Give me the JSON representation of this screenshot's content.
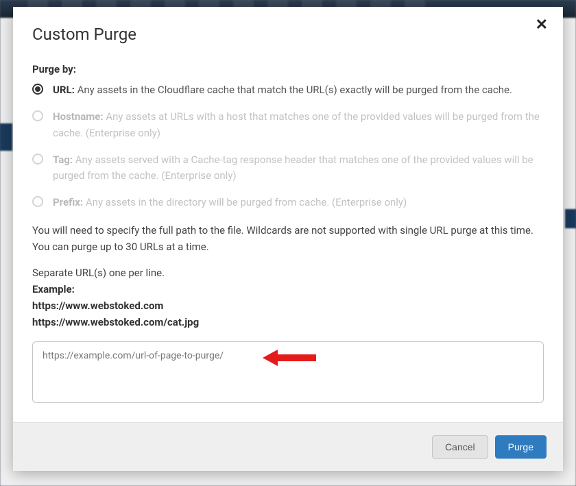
{
  "modal": {
    "title": "Custom Purge",
    "purge_by_label": "Purge by:",
    "options": [
      {
        "label": "URL:",
        "desc": "Any assets in the Cloudflare cache that match the URL(s) exactly will be purged from the cache.",
        "selected": true,
        "disabled": false
      },
      {
        "label": "Hostname:",
        "desc": "Any assets at URLs with a host that matches one of the provided values will be purged from the cache. (Enterprise only)",
        "selected": false,
        "disabled": true
      },
      {
        "label": "Tag:",
        "desc": "Any assets served with a Cache-tag response header that matches one of the provided values will be purged from the cache. (Enterprise only)",
        "selected": false,
        "disabled": true
      },
      {
        "label": "Prefix:",
        "desc": "Any assets in the directory will be purged from cache. (Enterprise only)",
        "selected": false,
        "disabled": true
      }
    ],
    "help_text": "You will need to specify the full path to the file. Wildcards are not supported with single URL purge at this time. You can purge up to 30 URLs at a time.",
    "separate_text": "Separate URL(s) one per line.",
    "example_label": "Example:",
    "example_lines": [
      "https://www.webstoked.com",
      "https://www.webstoked.com/cat.jpg"
    ],
    "textarea_value": "https://example.com/url-of-page-to-purge/"
  },
  "footer": {
    "cancel_label": "Cancel",
    "purge_label": "Purge"
  },
  "colors": {
    "primary": "#2f7bbf",
    "arrow": "#e31b1b"
  }
}
